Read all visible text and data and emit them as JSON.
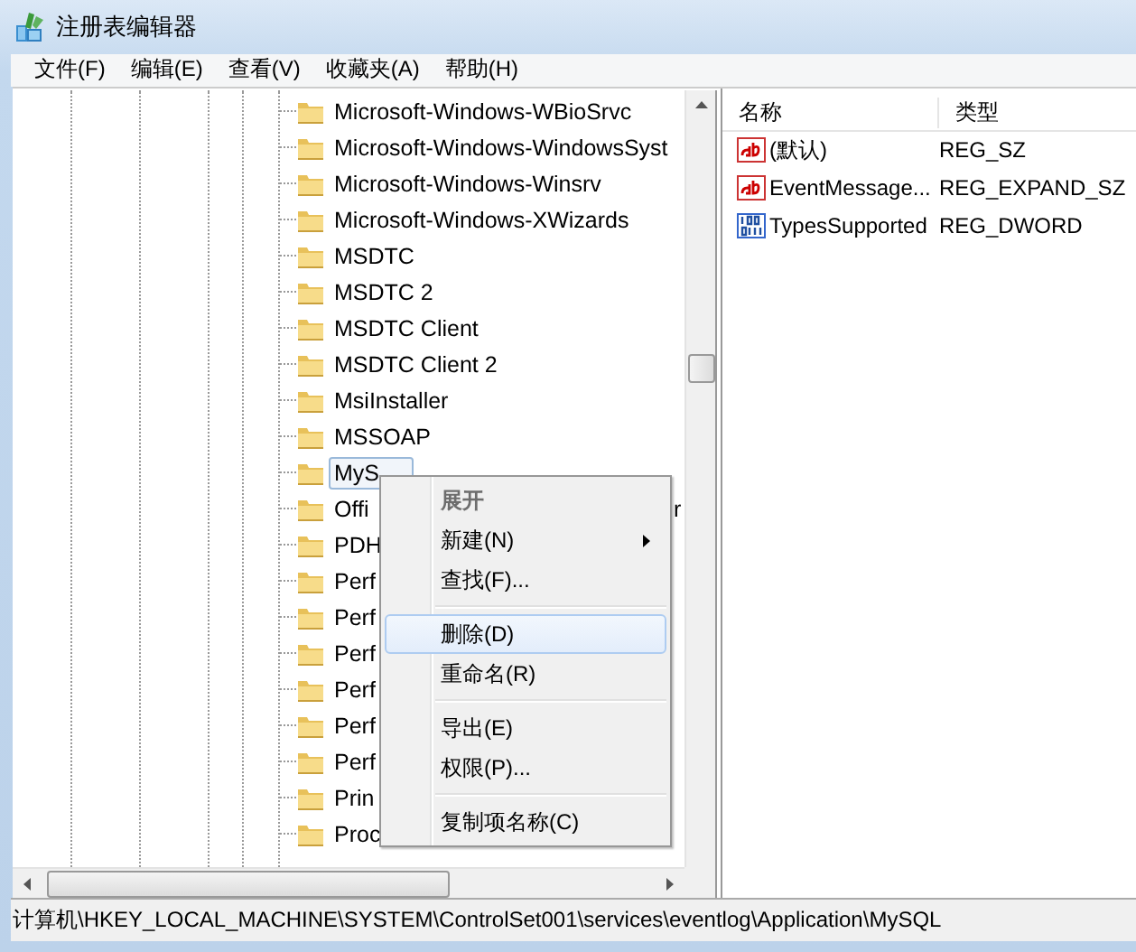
{
  "window": {
    "title": "注册表编辑器"
  },
  "menu_bar": [
    {
      "label": "文件(F)"
    },
    {
      "label": "编辑(E)"
    },
    {
      "label": "查看(V)"
    },
    {
      "label": "收藏夹(A)"
    },
    {
      "label": "帮助(H)"
    }
  ],
  "tree": {
    "items": [
      {
        "label": "Microsoft-Windows-WBioSrvc",
        "selected": false
      },
      {
        "label": "Microsoft-Windows-WindowsSyst",
        "selected": false
      },
      {
        "label": "Microsoft-Windows-Winsrv",
        "selected": false
      },
      {
        "label": "Microsoft-Windows-XWizards",
        "selected": false
      },
      {
        "label": "MSDTC",
        "selected": false
      },
      {
        "label": "MSDTC 2",
        "selected": false
      },
      {
        "label": "MSDTC Client",
        "selected": false
      },
      {
        "label": "MSDTC Client 2",
        "selected": false
      },
      {
        "label": "MsiInstaller",
        "selected": false
      },
      {
        "label": "MSSOAP",
        "selected": false
      },
      {
        "label": "MyS",
        "selected": true
      },
      {
        "label": "Offi",
        "selected": false,
        "tail": "r"
      },
      {
        "label": "PDH",
        "selected": false
      },
      {
        "label": "Perf",
        "selected": false
      },
      {
        "label": "Perf",
        "selected": false
      },
      {
        "label": "Perf",
        "selected": false
      },
      {
        "label": "Perf",
        "selected": false
      },
      {
        "label": "Perf",
        "selected": false
      },
      {
        "label": "Perf",
        "selected": false
      },
      {
        "label": "Prin",
        "selected": false
      },
      {
        "label": "Proc",
        "selected": false
      }
    ]
  },
  "values": {
    "columns": [
      "名称",
      "类型"
    ],
    "rows": [
      {
        "kind": "string",
        "name": "(默认)",
        "type": "REG_SZ"
      },
      {
        "kind": "string",
        "name": "EventMessage...",
        "type": "REG_EXPAND_SZ"
      },
      {
        "kind": "binary",
        "name": "TypesSupported",
        "type": "REG_DWORD"
      }
    ]
  },
  "context_menu": [
    {
      "kind": "item",
      "label": "展开",
      "default": true,
      "highlighted": false,
      "submenu": false
    },
    {
      "kind": "item",
      "label": "新建(N)",
      "default": false,
      "highlighted": false,
      "submenu": true
    },
    {
      "kind": "item",
      "label": "查找(F)...",
      "default": false,
      "highlighted": false,
      "submenu": false
    },
    {
      "kind": "separator"
    },
    {
      "kind": "item",
      "label": "删除(D)",
      "default": false,
      "highlighted": true,
      "submenu": false
    },
    {
      "kind": "item",
      "label": "重命名(R)",
      "default": false,
      "highlighted": false,
      "submenu": false
    },
    {
      "kind": "separator"
    },
    {
      "kind": "item",
      "label": "导出(E)",
      "default": false,
      "highlighted": false,
      "submenu": false
    },
    {
      "kind": "item",
      "label": "权限(P)...",
      "default": false,
      "highlighted": false,
      "submenu": false
    },
    {
      "kind": "separator"
    },
    {
      "kind": "item",
      "label": "复制项名称(C)",
      "default": false,
      "highlighted": false,
      "submenu": false
    }
  ],
  "status_bar": "计算机\\HKEY_LOCAL_MACHINE\\SYSTEM\\ControlSet001\\services\\eventlog\\Application\\MySQL"
}
